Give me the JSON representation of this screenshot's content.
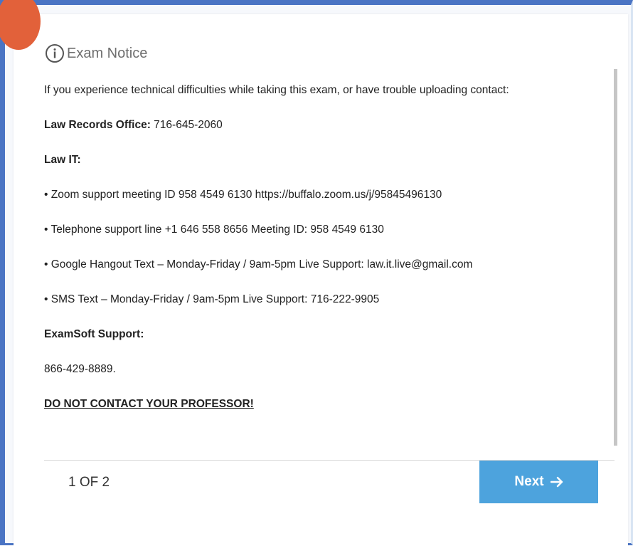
{
  "dialog": {
    "title": "Exam Notice",
    "icon": "info-icon"
  },
  "notice": {
    "intro": "If you experience technical difficulties while taking this exam, or have trouble uploading contact:",
    "law_records": {
      "label": "Law Records Office:",
      "phone": " 716-645-2060"
    },
    "law_it_heading": "Law IT:",
    "law_it_items": [
      "• Zoom support meeting ID 958 4549 6130 https://buffalo.zoom.us/j/95845496130",
      "• Telephone support line +1 646 558 8656 Meeting ID: 958 4549 6130",
      "• Google Hangout Text – Monday-Friday / 9am-5pm Live Support: law.it.live@gmail.com",
      "• SMS Text – Monday-Friday / 9am-5pm Live Support: 716-222-9905"
    ],
    "examsoft_heading": "ExamSoft Support:",
    "examsoft_phone": "866-429-8889.",
    "warning": "DO NOT CONTACT YOUR PROFESSOR!"
  },
  "footer": {
    "page_indicator": "1 OF 2",
    "next_label": "Next",
    "next_icon": "arrow-right-icon"
  },
  "colors": {
    "frame_border": "#4a74c4",
    "corner_badge": "#e2613a",
    "next_button": "#4da3dd",
    "title_text": "#6e6e6e"
  }
}
